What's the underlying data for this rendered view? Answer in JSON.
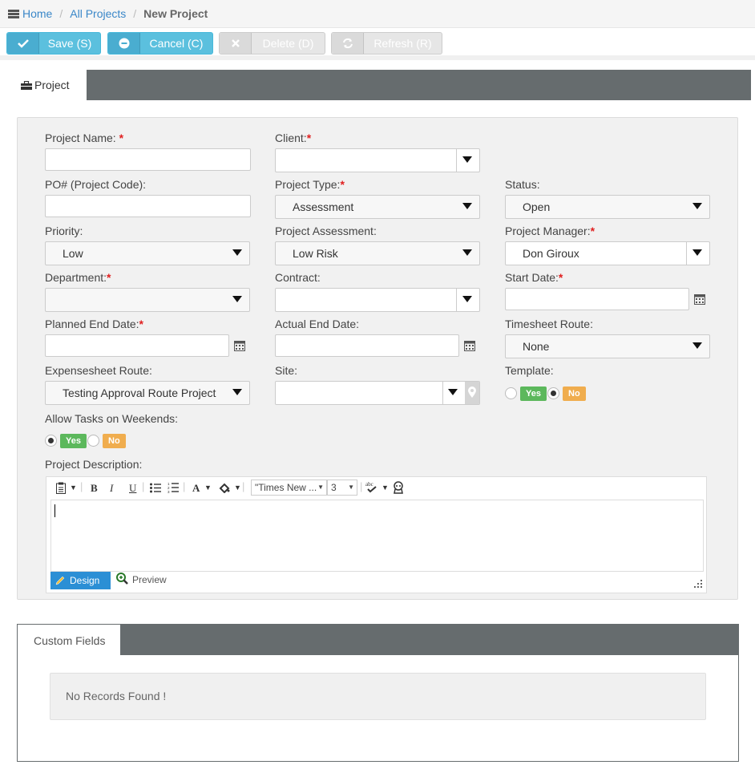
{
  "breadcrumb": {
    "home": "Home",
    "all_projects": "All Projects",
    "current": "New Project"
  },
  "toolbar": {
    "save": "Save (S)",
    "cancel": "Cancel (C)",
    "delete": "Delete (D)",
    "refresh": "Refresh (R)"
  },
  "tabs": {
    "project": "Project"
  },
  "form": {
    "project_name": "Project Name:",
    "client": "Client:",
    "po": "PO# (Project Code):",
    "project_type": "Project Type:",
    "project_type_value": "Assessment",
    "status": "Status:",
    "status_value": "Open",
    "priority": "Priority:",
    "priority_value": "Low",
    "project_assessment": "Project Assessment:",
    "project_assessment_value": "Low Risk",
    "project_manager": "Project Manager:",
    "project_manager_value": "Don Giroux",
    "department": "Department:",
    "contract": "Contract:",
    "start_date": "Start Date:",
    "planned_end_date": "Planned End Date:",
    "actual_end_date": "Actual End Date:",
    "timesheet_route": "Timesheet Route:",
    "timesheet_route_value": "None",
    "expensesheet_route": "Expensesheet Route:",
    "expensesheet_route_value": "Testing Approval Route Project",
    "site": "Site:",
    "template": "Template:",
    "allow_weekends": "Allow Tasks on Weekends:",
    "yes": "Yes",
    "no": "No",
    "required_mark": "*",
    "project_description": "Project Description:"
  },
  "editor": {
    "font_name": "\"Times New ...",
    "font_size": "3",
    "design": "Design",
    "preview": "Preview"
  },
  "custom_fields": {
    "tab": "Custom Fields",
    "empty": "No Records Found !"
  }
}
